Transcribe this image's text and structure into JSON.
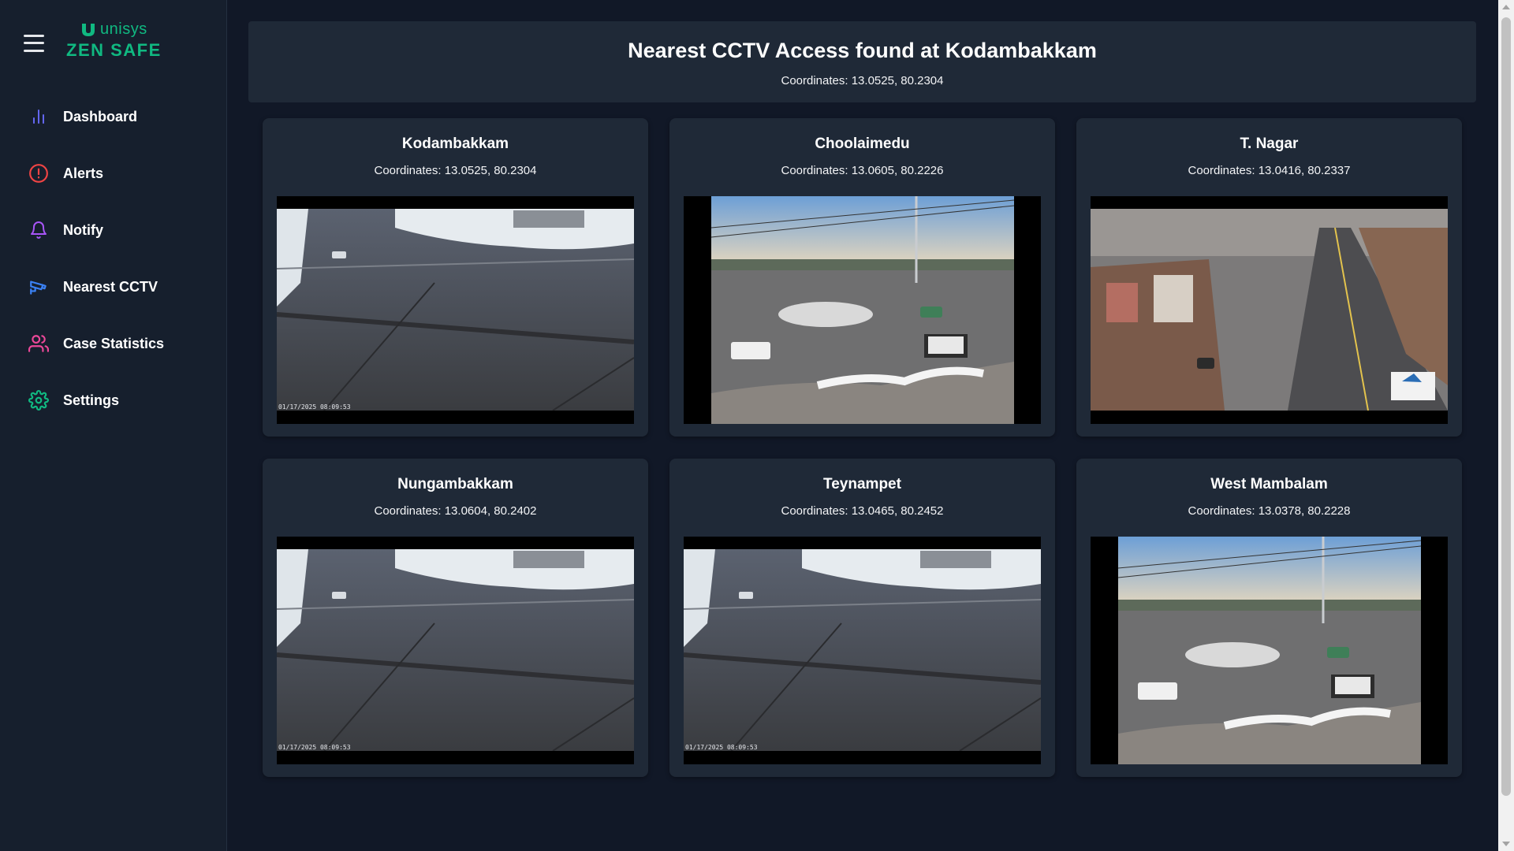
{
  "brand": {
    "company": "unisys",
    "product": "ZEN SAFE"
  },
  "nav": [
    {
      "label": "Dashboard",
      "icon": "bar-chart-icon",
      "color": "#6366f1"
    },
    {
      "label": "Alerts",
      "icon": "alert-circle-icon",
      "color": "#ef4444"
    },
    {
      "label": "Notify",
      "icon": "bell-icon",
      "color": "#a855f7"
    },
    {
      "label": "Nearest CCTV",
      "icon": "cctv-camera-icon",
      "color": "#3b82f6"
    },
    {
      "label": "Case Statistics",
      "icon": "users-icon",
      "color": "#ec4899"
    },
    {
      "label": "Settings",
      "icon": "gear-icon",
      "color": "#10b981"
    }
  ],
  "header": {
    "title": "Nearest CCTV Access found at Kodambakkam",
    "coordinates": "Coordinates: 13.0525, 80.2304"
  },
  "cameras": [
    {
      "name": "Kodambakkam",
      "coordinates": "Coordinates: 13.0525, 80.2304",
      "feed": "intersection-snow",
      "timestamp": "01/17/2025 08:09:53"
    },
    {
      "name": "Choolaimedu",
      "coordinates": "Coordinates: 13.0605, 80.2226",
      "feed": "roundabout",
      "timestamp": ""
    },
    {
      "name": "T. Nagar",
      "coordinates": "Coordinates: 13.0416, 80.2337",
      "feed": "town-street",
      "timestamp": ""
    },
    {
      "name": "Nungambakkam",
      "coordinates": "Coordinates: 13.0604, 80.2402",
      "feed": "intersection-snow",
      "timestamp": "01/17/2025 08:09:53"
    },
    {
      "name": "Teynampet",
      "coordinates": "Coordinates: 13.0465, 80.2452",
      "feed": "intersection-snow",
      "timestamp": "01/17/2025 08:09:53"
    },
    {
      "name": "West Mambalam",
      "coordinates": "Coordinates: 13.0378, 80.2228",
      "feed": "roundabout",
      "timestamp": ""
    }
  ],
  "colors": {
    "accent": "#10b981",
    "background": "#111827",
    "card": "#1f2937",
    "sidebar": "#161f2d"
  }
}
